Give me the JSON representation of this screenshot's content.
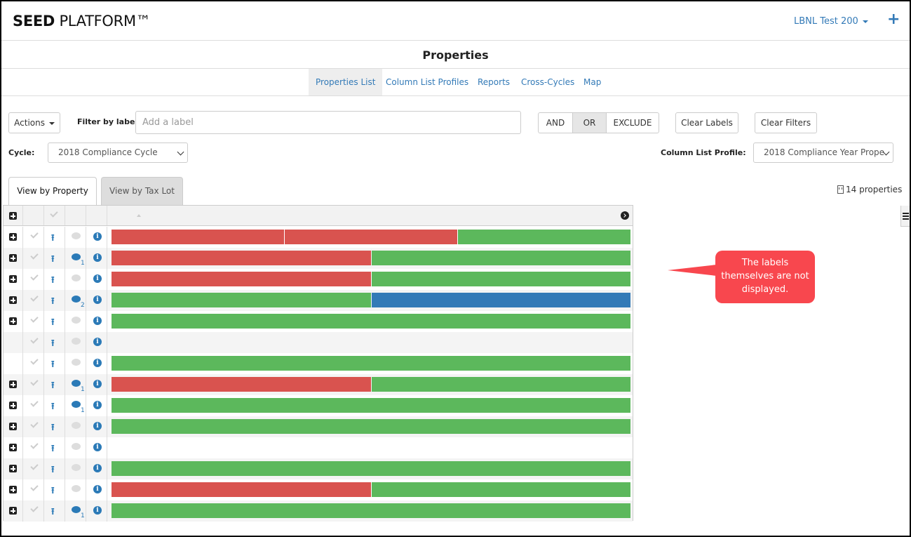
{
  "brand": {
    "bold": "SEED",
    "rest": "PLATFORM™"
  },
  "header": {
    "org": "LBNL Test 200",
    "plus_icon": "+"
  },
  "page_title": "Properties",
  "subnav": [
    {
      "label": "Properties List",
      "active": true
    },
    {
      "label": "Column List Profiles"
    },
    {
      "label": "Reports"
    },
    {
      "label": "Cross-Cycles"
    },
    {
      "label": "Map"
    }
  ],
  "toolbar": {
    "actions_label": "Actions",
    "filter_label": "Filter by label:",
    "filter_placeholder": "Add a label",
    "logic": {
      "and": "AND",
      "or": "OR",
      "exclude": "EXCLUDE",
      "selected": "OR"
    },
    "clear_labels": "Clear Labels",
    "clear_filters": "Clear Filters",
    "cycle_label": "Cycle:",
    "cycle_value": "2018 Compliance Cycle",
    "profile_label": "Column List Profile:",
    "profile_value": "2018 Compliance Year Prope"
  },
  "view_tabs": {
    "by_property": "View by Property",
    "by_taxlot": "View by Tax Lot"
  },
  "count": "14 properties",
  "colors": {
    "red": "#d9534f",
    "green": "#5cb85c",
    "blue": "#337ab7"
  },
  "rows": [
    {
      "expand": true,
      "notes": 0,
      "labels": [
        "red",
        "red",
        "green"
      ]
    },
    {
      "expand": true,
      "notes": 1,
      "labels": [
        "red",
        "green"
      ]
    },
    {
      "expand": true,
      "notes": 0,
      "labels": [
        "red",
        "green"
      ]
    },
    {
      "expand": true,
      "notes": 2,
      "labels": [
        "green",
        "blue"
      ]
    },
    {
      "expand": true,
      "notes": 0,
      "labels": [
        "green"
      ]
    },
    {
      "expand": false,
      "notes": 0,
      "labels": []
    },
    {
      "expand": false,
      "notes": 0,
      "labels": [
        "green"
      ]
    },
    {
      "expand": true,
      "notes": 1,
      "labels": [
        "red",
        "green"
      ]
    },
    {
      "expand": true,
      "notes": 1,
      "labels": [
        "green"
      ]
    },
    {
      "expand": true,
      "notes": 0,
      "labels": [
        "green"
      ]
    },
    {
      "expand": true,
      "notes": 0,
      "labels": []
    },
    {
      "expand": true,
      "notes": 0,
      "labels": [
        "green"
      ]
    },
    {
      "expand": true,
      "notes": 0,
      "labels": [
        "red",
        "green"
      ]
    },
    {
      "expand": true,
      "notes": 1,
      "labels": [
        "green"
      ]
    }
  ],
  "callout": "The labels themselves are not displayed."
}
